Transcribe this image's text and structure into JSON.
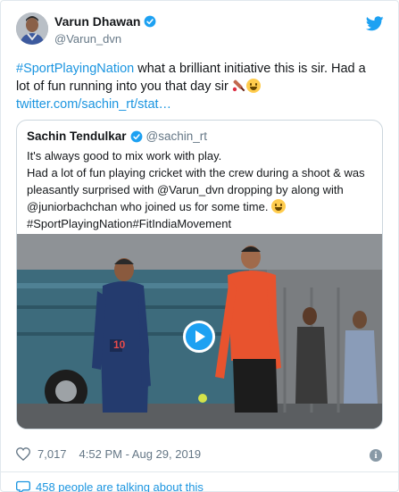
{
  "tweet": {
    "author_name": "Varun Dhawan",
    "author_handle": "@Varun_dvn",
    "hashtag": "#SportPlayingNation",
    "text": " what a brilliant initiative this is sir. Had a lot of fun running into you that day sir ",
    "link": "twitter.com/sachin_rt/stat…"
  },
  "quoted": {
    "author_name": "Sachin Tendulkar",
    "author_handle": "@sachin_rt",
    "line1": "It's always good to mix work with play.",
    "line2": "Had a lot of fun playing cricket with the crew during a shoot & was pleasantly surprised with @Varun_dvn dropping by along with @juniorbachchan who joined us for some time. ",
    "hashtags": "#SportPlayingNation#FitIndiaMovement"
  },
  "video": {
    "jersey_number": "10"
  },
  "footer": {
    "likes": "7,017",
    "timestamp": "4:52 PM - Aug 29, 2019",
    "info_icon": "i",
    "talking": "458 people are talking about this"
  },
  "colors": {
    "accent": "#1da1f2",
    "link": "#1b95e0",
    "muted": "#657786"
  },
  "icons": [
    "verified-badge-icon",
    "twitter-bird-icon",
    "cricket-bat-icon",
    "grinning-emoji-icon",
    "play-icon",
    "heart-icon",
    "info-icon",
    "speech-bubble-icon"
  ]
}
